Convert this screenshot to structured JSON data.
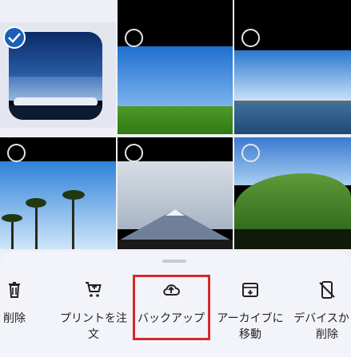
{
  "actions": [
    {
      "id": "delete",
      "label": "削除",
      "icon": "trash-icon"
    },
    {
      "id": "print",
      "label": "プリントを注文",
      "icon": "cart-icon"
    },
    {
      "id": "backup",
      "label": "バックアップ",
      "icon": "cloud-upload-icon"
    },
    {
      "id": "archive",
      "label": "アーカイブに移動",
      "icon": "archive-icon"
    },
    {
      "id": "device-delete",
      "label": "デバイスから削除",
      "icon": "device-off-icon"
    }
  ],
  "colors": {
    "accent": "#1a5fb8",
    "highlight": "#d42a2a"
  }
}
